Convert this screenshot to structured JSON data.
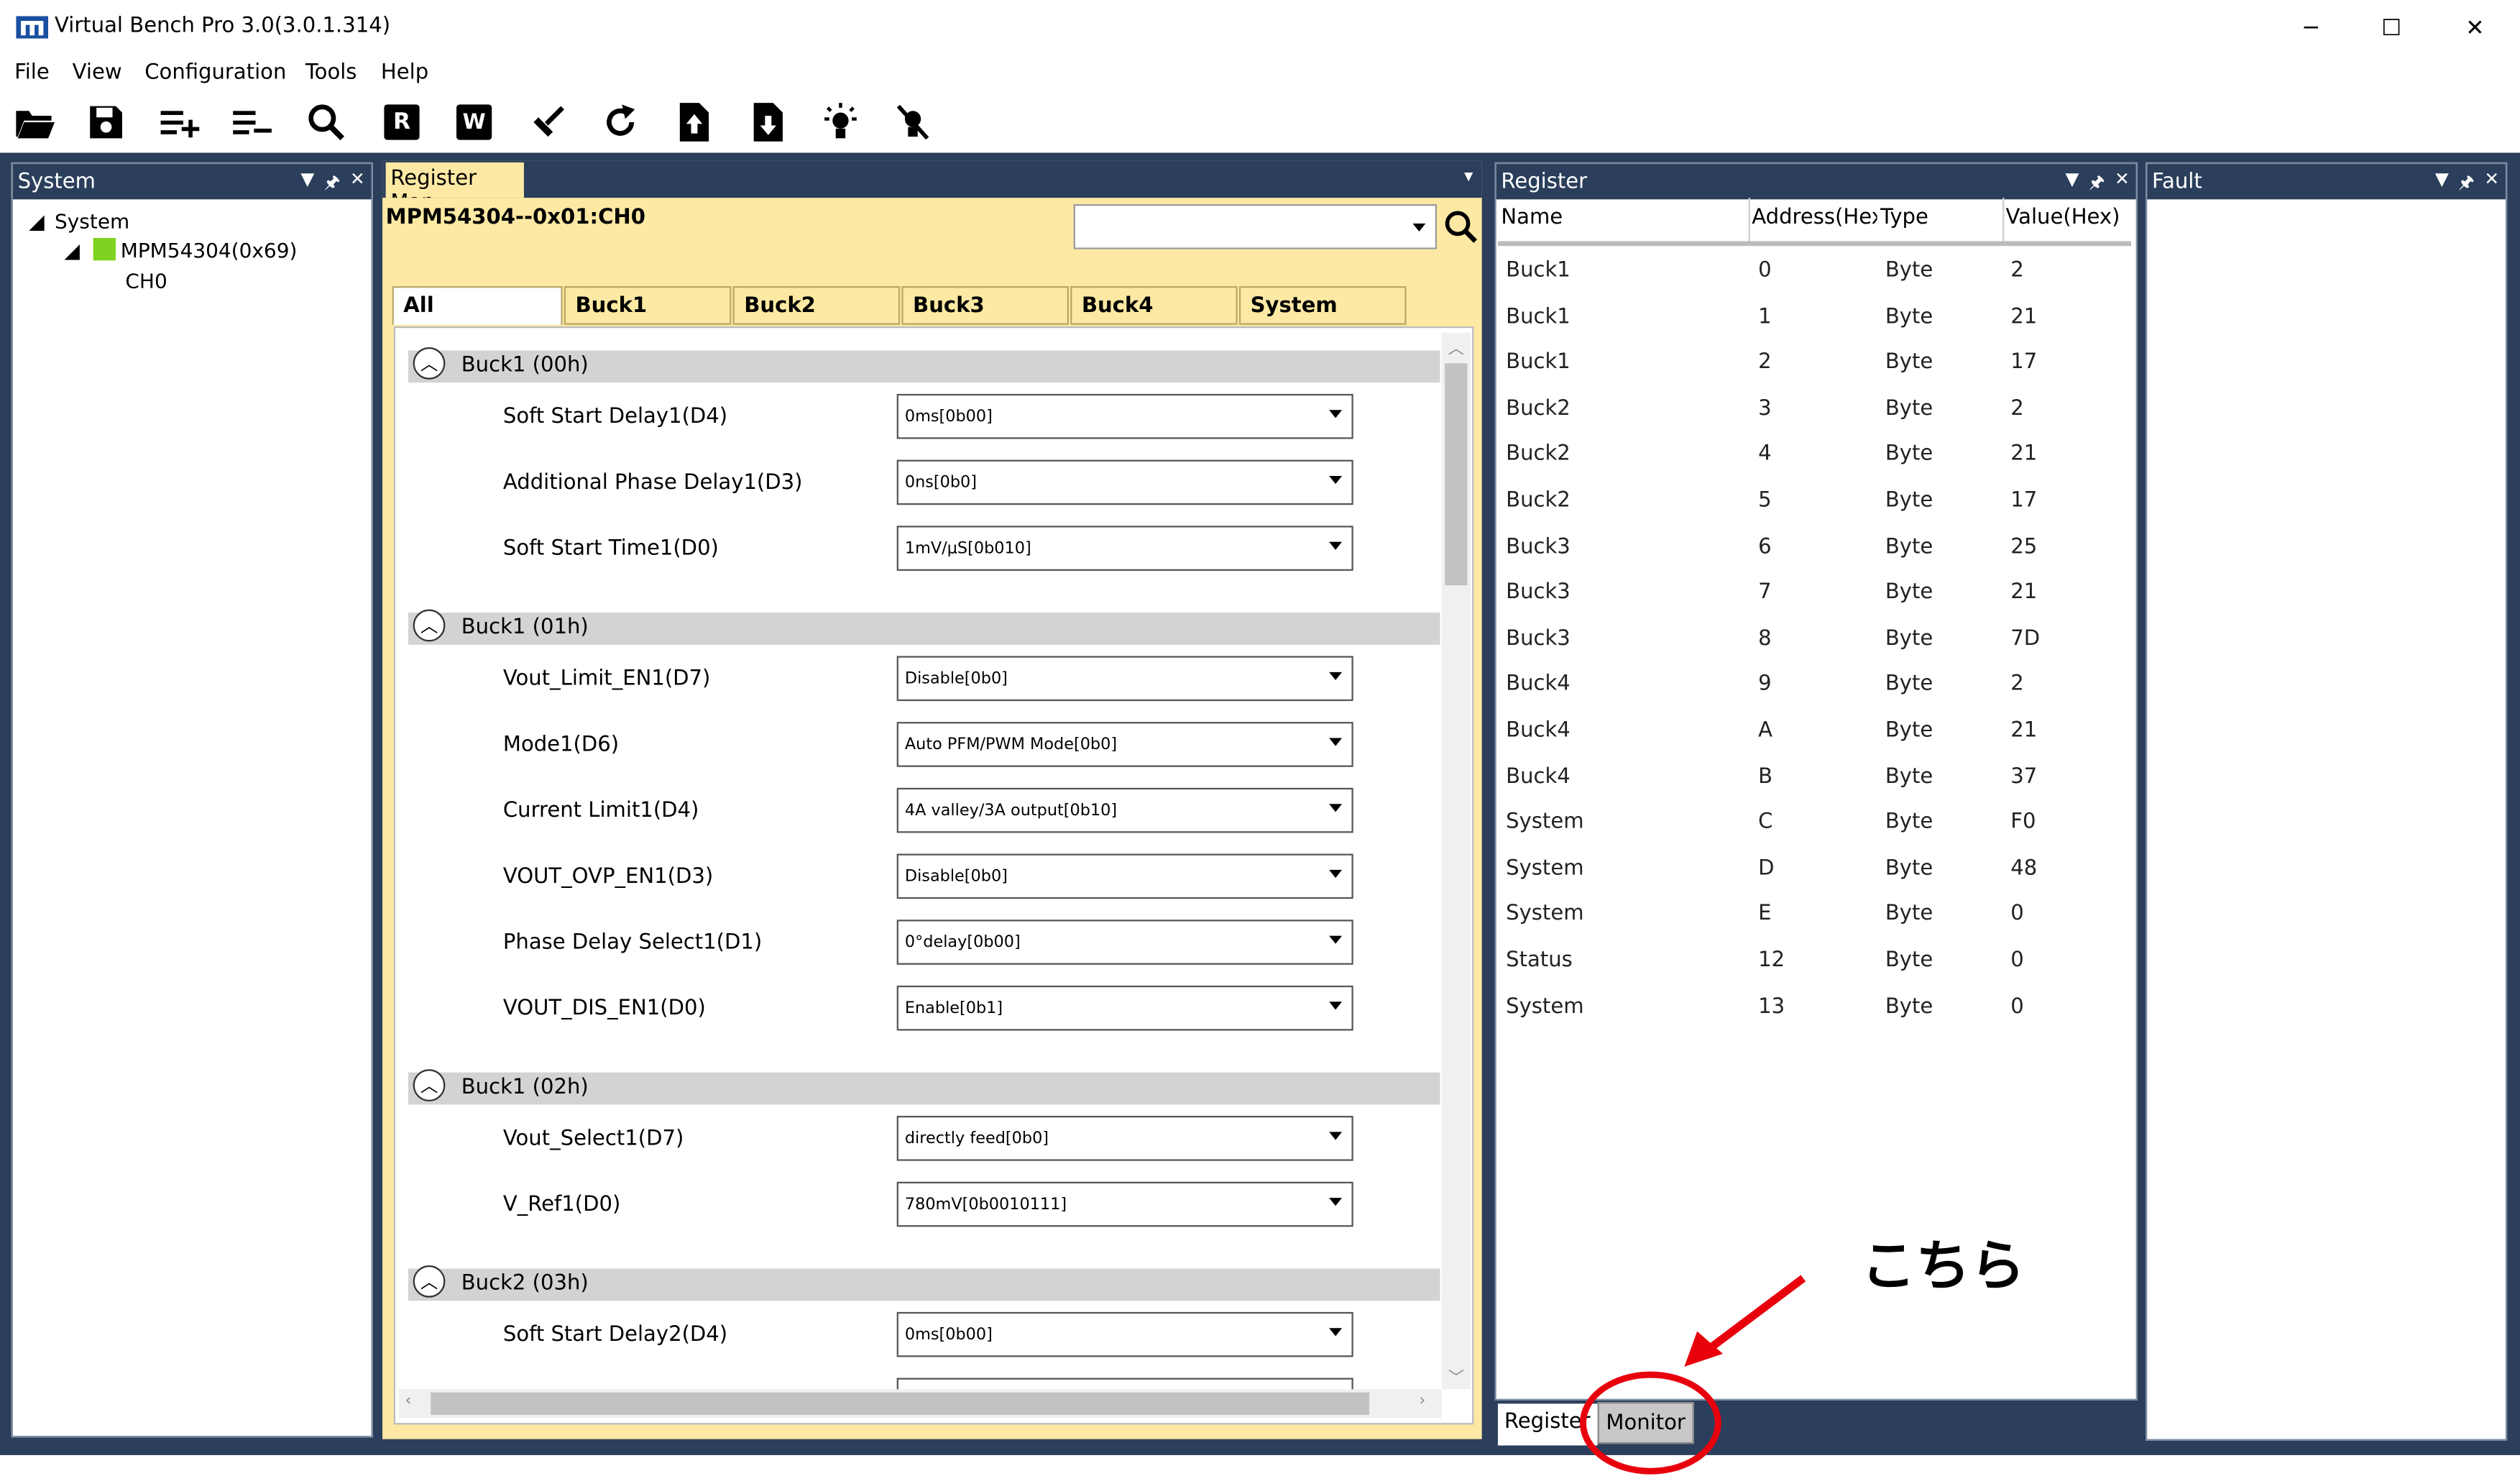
{
  "window": {
    "title": "Virtual Bench Pro 3.0(3.0.1.314)",
    "minimize_glyph": "─",
    "maximize_glyph": "☐",
    "close_glyph": "✕"
  },
  "menu": [
    "File",
    "View",
    "Configuration",
    "Tools",
    "Help"
  ],
  "toolbar": {
    "icons": [
      "open-folder-icon",
      "save-icon",
      "add-list-icon",
      "remove-list-icon",
      "search-icon",
      "read-register-icon",
      "write-register-icon",
      "clear-icon",
      "refresh-icon",
      "upload-icon",
      "download-icon",
      "light-on-icon",
      "light-off-icon"
    ],
    "read_label": "R",
    "write_label": "W"
  },
  "system_panel": {
    "title": "System",
    "tree": {
      "root": "System",
      "device": "MPM54304(0x69)",
      "channel": "CH0"
    },
    "device_color": "#7ed321"
  },
  "register_map": {
    "tab": "Register Map",
    "channel": "MPM54304--0x01:CH0",
    "tabs": [
      "All",
      "Buck1",
      "Buck2",
      "Buck3",
      "Buck4",
      "System"
    ],
    "sections": [
      {
        "title": "Buck1  (00h)",
        "fields": [
          {
            "label": "Soft Start Delay1(D4)",
            "value": "0ms[0b00]"
          },
          {
            "label": "Additional Phase Delay1(D3)",
            "value": "0ns[0b0]"
          },
          {
            "label": "Soft Start Time1(D0)",
            "value": "1mV/μS[0b010]"
          }
        ]
      },
      {
        "title": "Buck1  (01h)",
        "fields": [
          {
            "label": "Vout_Limit_EN1(D7)",
            "value": "Disable[0b0]"
          },
          {
            "label": "Mode1(D6)",
            "value": "Auto PFM/PWM Mode[0b0]"
          },
          {
            "label": "Current Limit1(D4)",
            "value": "4A valley/3A output[0b10]"
          },
          {
            "label": "VOUT_OVP_EN1(D3)",
            "value": "Disable[0b0]"
          },
          {
            "label": "Phase Delay Select1(D1)",
            "value": "0°delay[0b00]"
          },
          {
            "label": "VOUT_DIS_EN1(D0)",
            "value": "Enable[0b1]"
          }
        ]
      },
      {
        "title": "Buck1  (02h)",
        "fields": [
          {
            "label": "Vout_Select1(D7)",
            "value": "directly feed[0b0]"
          },
          {
            "label": "V_Ref1(D0)",
            "value": "780mV[0b0010111]"
          }
        ]
      },
      {
        "title": "Buck2  (03h)",
        "fields": [
          {
            "label": "Soft Start Delay2(D4)",
            "value": "0ms[0b00]"
          }
        ]
      }
    ]
  },
  "register_panel": {
    "title": "Register",
    "columns": [
      "Name",
      "Address(Hex)",
      "Type",
      "Value(Hex)"
    ],
    "rows": [
      [
        "Buck1",
        "0",
        "Byte",
        "2"
      ],
      [
        "Buck1",
        "1",
        "Byte",
        "21"
      ],
      [
        "Buck1",
        "2",
        "Byte",
        "17"
      ],
      [
        "Buck2",
        "3",
        "Byte",
        "2"
      ],
      [
        "Buck2",
        "4",
        "Byte",
        "21"
      ],
      [
        "Buck2",
        "5",
        "Byte",
        "17"
      ],
      [
        "Buck3",
        "6",
        "Byte",
        "25"
      ],
      [
        "Buck3",
        "7",
        "Byte",
        "21"
      ],
      [
        "Buck3",
        "8",
        "Byte",
        "7D"
      ],
      [
        "Buck4",
        "9",
        "Byte",
        "2"
      ],
      [
        "Buck4",
        "A",
        "Byte",
        "21"
      ],
      [
        "Buck4",
        "B",
        "Byte",
        "37"
      ],
      [
        "System",
        "C",
        "Byte",
        "F0"
      ],
      [
        "System",
        "D",
        "Byte",
        "48"
      ],
      [
        "System",
        "E",
        "Byte",
        "0"
      ],
      [
        "Status",
        "12",
        "Byte",
        "0"
      ],
      [
        "System",
        "13",
        "Byte",
        "0"
      ]
    ]
  },
  "fault_panel": {
    "title": "Fault"
  },
  "bottom_tabs": {
    "register": "Register",
    "monitor": "Monitor"
  },
  "annotation": {
    "text": "こちら",
    "color": "#e8000d"
  },
  "panel_icons": {
    "dropdown": "▼",
    "pin": "🖈",
    "close": "✕"
  },
  "colors": {
    "workspace": "#2b3f5c",
    "regmap_bg": "#fde9a3"
  }
}
